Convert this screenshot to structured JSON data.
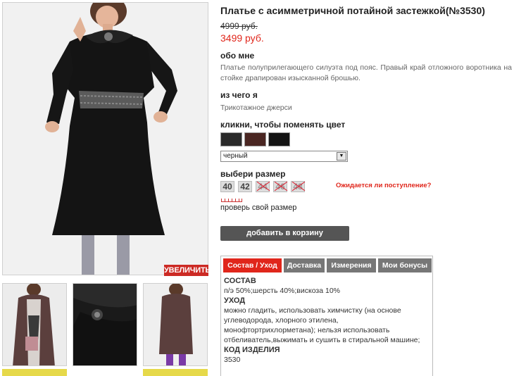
{
  "product": {
    "title": "Платье с асимметричной потайной застежкой(№3530)",
    "old_price": "4999 руб.",
    "new_price": "3499 руб."
  },
  "gallery": {
    "zoom_label": "УВЕЛИЧИТЬ"
  },
  "about": {
    "heading": "обо мне",
    "text": "Платье полуприлегающего силуэта под пояс. Правый край отложного воротника на стойке драпирован изысканной брошью."
  },
  "material": {
    "heading": "из чего я",
    "text": "Трикотажное джерси"
  },
  "color": {
    "heading": "кликни, чтобы поменять цвет",
    "swatches": [
      "#2a2a2a",
      "#4a2622",
      "#141414"
    ],
    "selected": "черный"
  },
  "size": {
    "heading": "выбери размер",
    "options": [
      "40",
      "42",
      "44",
      "46",
      "48"
    ],
    "available": [
      true,
      true,
      false,
      false,
      false
    ],
    "await_link": "Ожидается ли поступление?",
    "check_size": "проверь свой размер"
  },
  "cart": {
    "button": "добавить в корзину"
  },
  "tabs": {
    "labels": [
      "Состав / Уход",
      "Доставка",
      "Измерения",
      "Мои бонусы"
    ],
    "active": 0,
    "composition_heading": "СОСТАВ",
    "composition": "п/э 50%;шерсть 40%;вискоза 10%",
    "care_heading": "УХОД",
    "care": "можно гладить, использовать химчистку (на основе углеводорода, хлорного этилена, монофтортрихлорметана); нельзя использовать отбеливатель,выжимать и сушить в стиральной машине;",
    "code_heading": "КОД ИЗДЕЛИЯ",
    "code": "3530"
  },
  "colors": {
    "accent_red": "#e0261b",
    "button_gray": "#555555",
    "tab_gray": "#777777"
  }
}
